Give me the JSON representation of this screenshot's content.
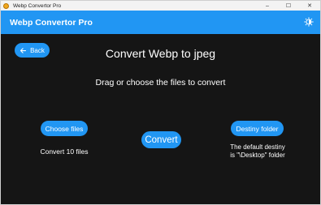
{
  "window": {
    "title": "Webp Convertor Pro",
    "controls": {
      "minimize": "–",
      "maximize": "☐",
      "close": "✕"
    }
  },
  "appbar": {
    "title": "Webp Convertor Pro",
    "theme_icon": "brightness-icon"
  },
  "page": {
    "back_label": "Back",
    "heading": "Convert Webp to jpeg",
    "subheading": "Drag or choose the files to convert",
    "choose_files_label": "Choose files",
    "convert_label": "Convert",
    "destiny_folder_label": "Destiny folder",
    "file_count_text": "Convert 10 files",
    "destiny_text_line1": "The default destiny",
    "destiny_text_line2": "is \"\\Desktop\" folder"
  },
  "colors": {
    "accent": "#2196f3",
    "background": "#151515",
    "text": "#ffffff"
  }
}
